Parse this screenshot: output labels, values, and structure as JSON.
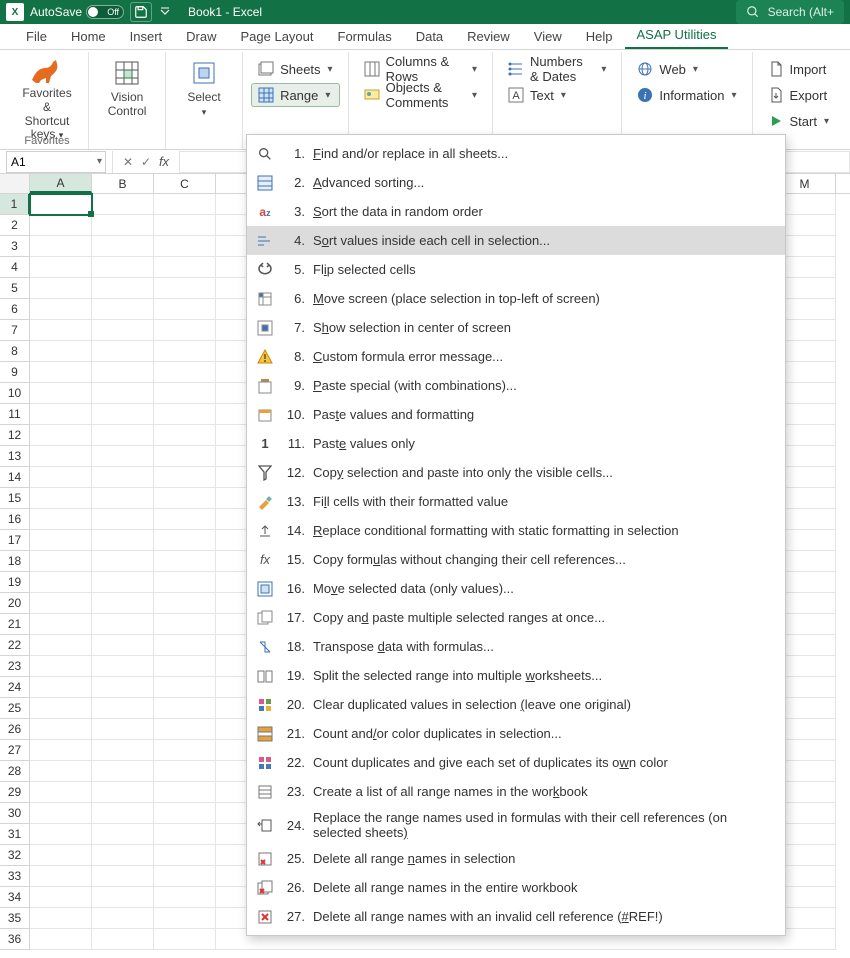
{
  "titlebar": {
    "autosave_label": "AutoSave",
    "autosave_state": "Off",
    "book_title": "Book1  -  Excel",
    "search_placeholder": "Search (Alt+"
  },
  "tabs": [
    "File",
    "Home",
    "Insert",
    "Draw",
    "Page Layout",
    "Formulas",
    "Data",
    "Review",
    "View",
    "Help",
    "ASAP Utilities"
  ],
  "active_tab": "ASAP Utilities",
  "ribbon": {
    "favorites": {
      "label": "Favorites &\nShortcut keys",
      "group": "Favorites"
    },
    "vision": "Vision\nControl",
    "select": "Select",
    "sheets": "Sheets",
    "columns": "Columns & Rows",
    "range": "Range",
    "objects": "Objects & Comments",
    "numbers": "Numbers & Dates",
    "text": "Text",
    "web": "Web",
    "information": "Information",
    "import_": "Import",
    "export_": "Export",
    "start": "Start"
  },
  "namebox": "A1",
  "cols": [
    "A",
    "B",
    "C",
    "",
    "",
    "",
    "",
    "",
    "",
    "",
    "",
    "",
    "M"
  ],
  "dropdown": [
    {
      "n": "1.",
      "t": "<u>F</u>ind and/or replace in all sheets..."
    },
    {
      "n": "2.",
      "t": "<u>A</u>dvanced sorting..."
    },
    {
      "n": "3.",
      "t": "<u>S</u>ort the data in random order"
    },
    {
      "n": "4.",
      "t": "S<u>o</u>rt values inside each cell in selection...",
      "hover": true
    },
    {
      "n": "5.",
      "t": "Fl<u>i</u>p selected cells"
    },
    {
      "n": "6.",
      "t": "<u>M</u>ove screen (place selection in top-left of screen)"
    },
    {
      "n": "7.",
      "t": "S<u>h</u>ow selection in center of screen"
    },
    {
      "n": "8.",
      "t": "<u>C</u>ustom formula error message..."
    },
    {
      "n": "9.",
      "t": "<u>P</u>aste special (with combinations)..."
    },
    {
      "n": "10.",
      "t": "Pas<u>t</u>e values and formatting"
    },
    {
      "n": "11.",
      "t": "Past<u>e</u> values only"
    },
    {
      "n": "12.",
      "t": "Cop<u>y</u> selection and paste into only the visible cells..."
    },
    {
      "n": "13.",
      "t": "Fi<u>l</u>l cells with their formatted value"
    },
    {
      "n": "14.",
      "t": "<u>R</u>eplace conditional formatting with static formatting in selection"
    },
    {
      "n": "15.",
      "t": "Copy form<u>u</u>las without changing their cell references..."
    },
    {
      "n": "16.",
      "t": "Mo<u>v</u>e selected data (only values)..."
    },
    {
      "n": "17.",
      "t": "Copy an<u>d</u> paste multiple selected ranges at once..."
    },
    {
      "n": "18.",
      "t": "Transpose <u>d</u>ata with formulas..."
    },
    {
      "n": "19.",
      "t": "Split the selected range into multiple <u>w</u>orksheets..."
    },
    {
      "n": "20.",
      "t": "Clear duplicated values in selection <u>(</u>leave one original)"
    },
    {
      "n": "21.",
      "t": "Count and<u>/</u>or color duplicates in selection..."
    },
    {
      "n": "22.",
      "t": "Count duplicates and give each set of duplicates its o<u>w</u>n color"
    },
    {
      "n": "23.",
      "t": "Create a list of all range names in the wor<u>k</u>book"
    },
    {
      "n": "24.",
      "t": "Replace the range names used in formulas with their cell references (on selected sheets<u>)</u>"
    },
    {
      "n": "25.",
      "t": "Delete all range <u>n</u>ames in selection"
    },
    {
      "n": "26.",
      "t": "Delete all ran<u>g</u>e names in the entire workbook"
    },
    {
      "n": "27.",
      "t": "Delete all range names with an invalid cell reference (<u>#</u>REF!)"
    }
  ]
}
